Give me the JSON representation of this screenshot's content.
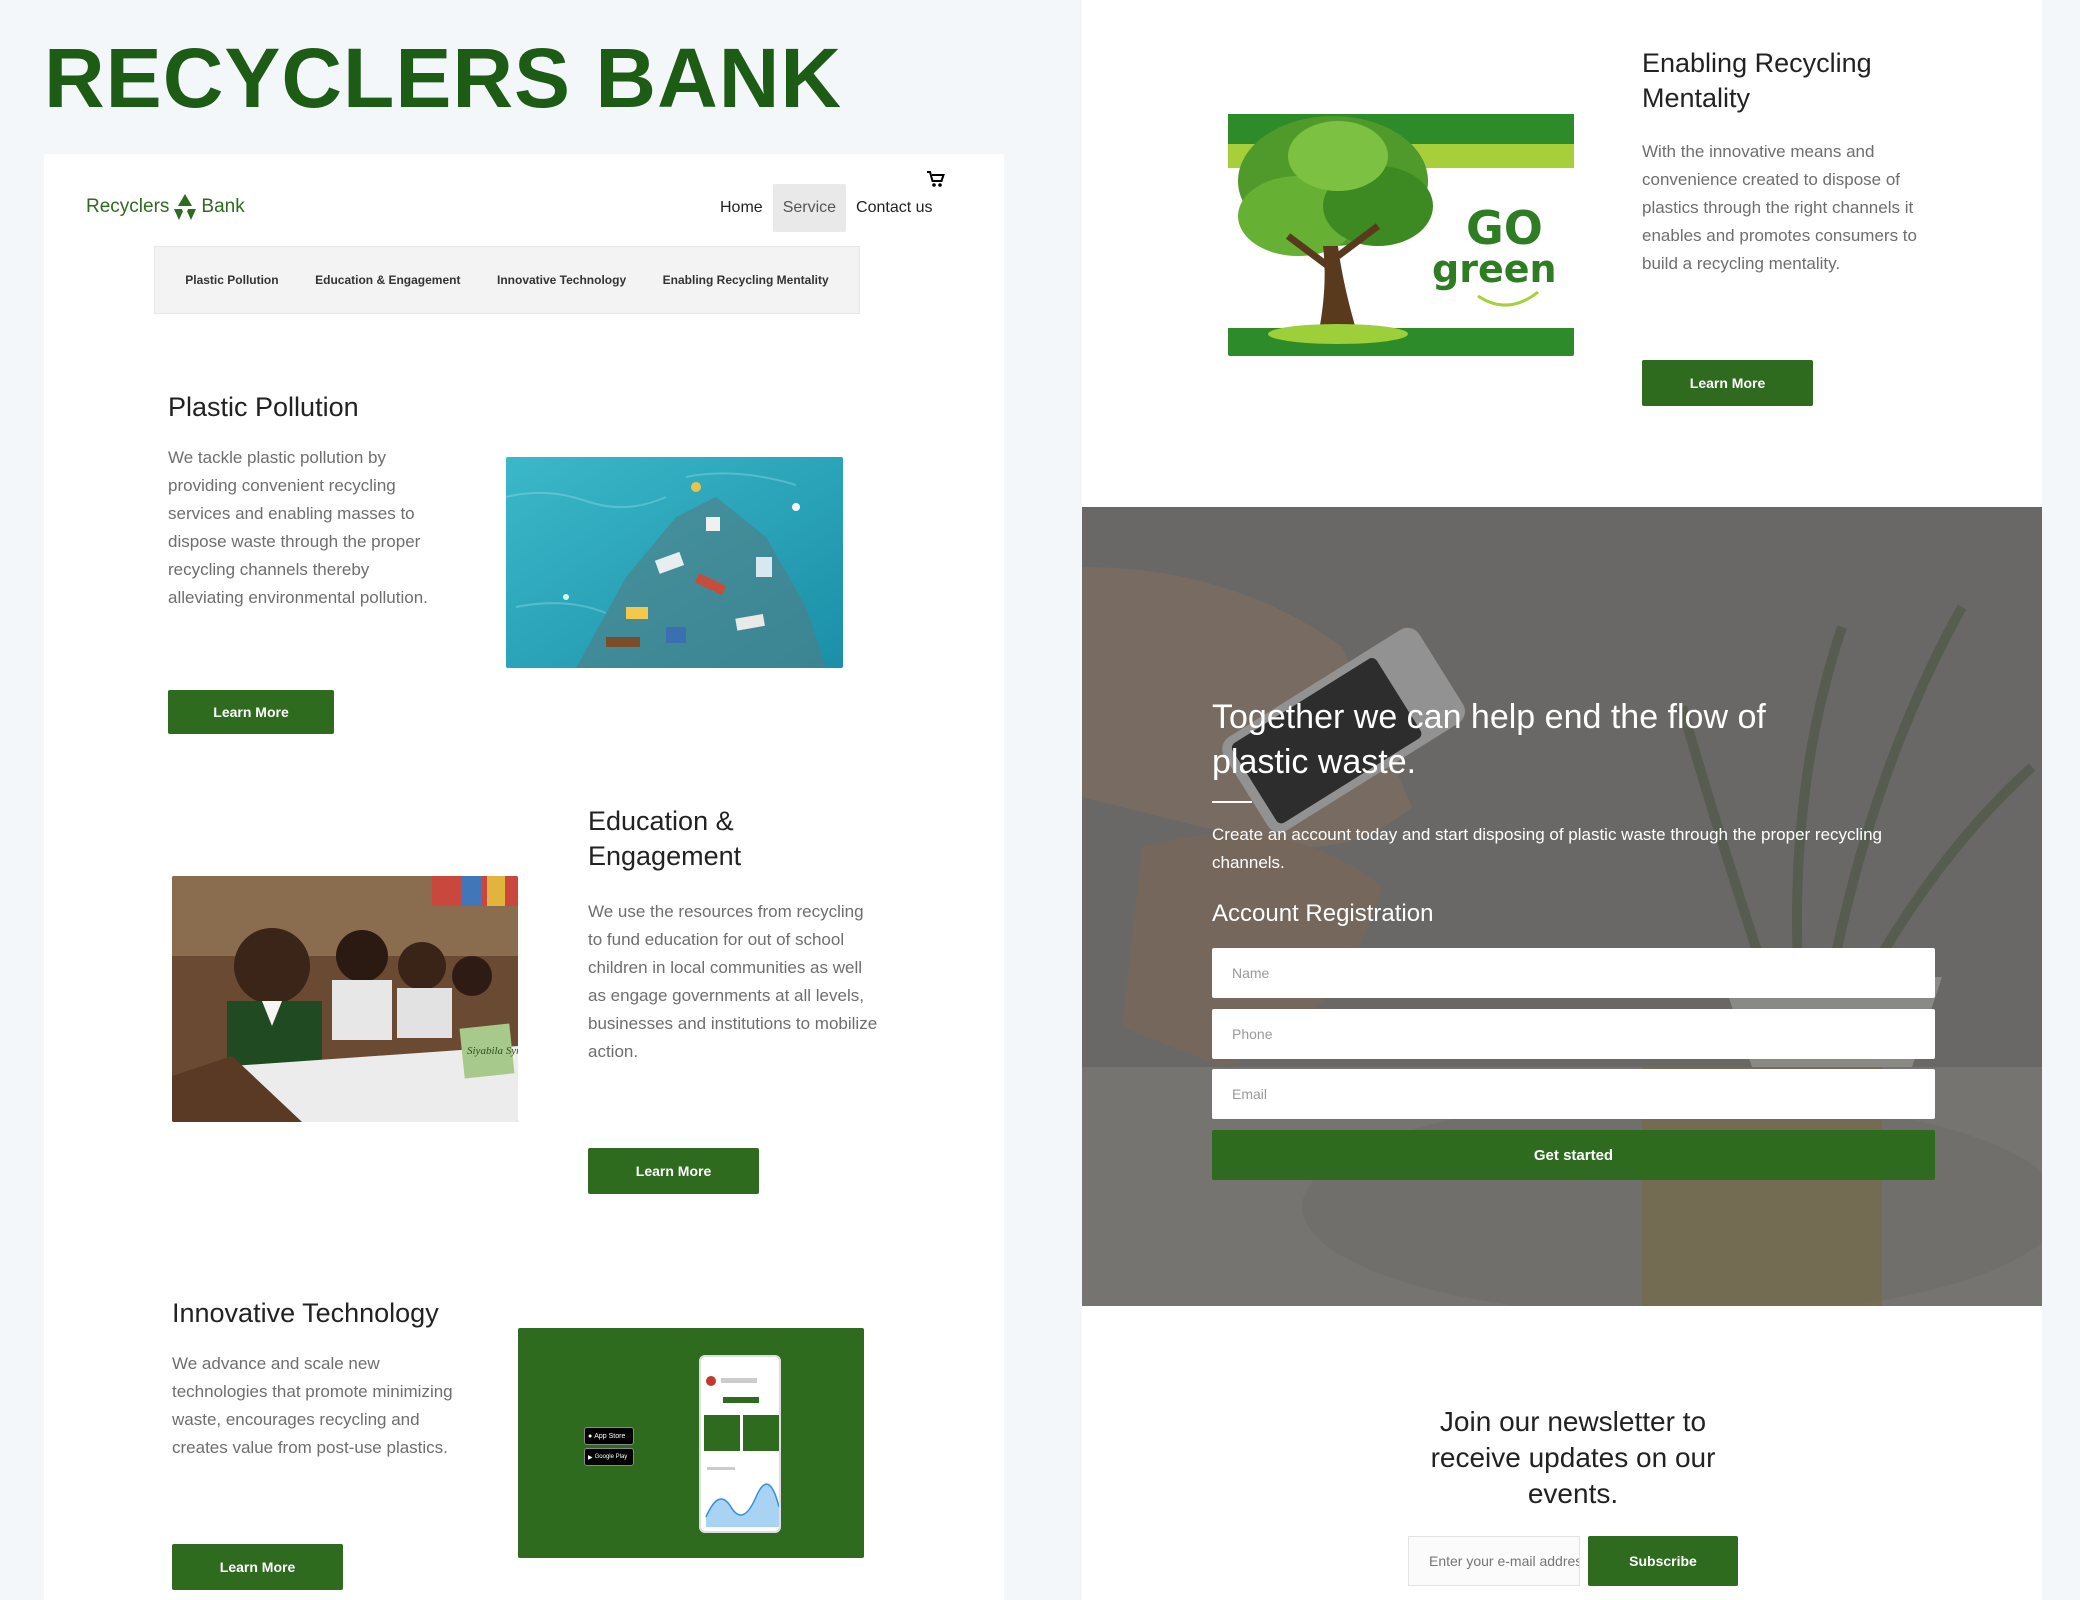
{
  "poster_title": "RECYCLERS BANK",
  "brand": {
    "left": "Recyclers",
    "right": "Bank",
    "color": "#2e6b1f"
  },
  "cart_icon": "shopping-cart-icon",
  "nav": {
    "home": "Home",
    "service": "Service",
    "contact": "Contact us"
  },
  "subnav": [
    "Plastic Pollution",
    "Education & Engagement",
    "Innovative Technology",
    "Enabling Recycling Mentality"
  ],
  "sections": {
    "plastic": {
      "title": "Plastic Pollution",
      "text": "We tackle plastic pollution by providing convenient recycling services and enabling masses to dispose waste through the proper recycling channels thereby alleviating environmental pollution.",
      "button": "Learn More"
    },
    "education": {
      "title": "Education & Engagement",
      "text": "We use the resources from recycling to fund education for out of school children in local communities as well as engage governments at all levels, businesses and institutions to mobilize action.",
      "button": "Learn More",
      "image_sign": "Siyabila Symbols"
    },
    "innovative": {
      "title": "Innovative Technology",
      "text": "We advance and scale new technologies that promote minimizing waste, encourages recycling and creates value from post-use plastics.",
      "button": "Learn More",
      "app_store": "App Store",
      "google_play": "Google Play"
    },
    "mentality": {
      "title": "Enabling Recycling Mentality",
      "text": "With the innovative means and convenience created to dispose of plastics through the right channels it enables and promotes consumers to build a recycling mentality.",
      "button": "Learn More",
      "go_text": "GO",
      "green_text": "green"
    }
  },
  "hero": {
    "title": "Together we can help end the flow of plastic waste.",
    "text": "Create an account today and start disposing of plastic waste through the proper recycling channels.",
    "form_title": "Account Registration",
    "name_placeholder": "Name",
    "phone_placeholder": "Phone",
    "email_placeholder": "Email",
    "submit": "Get started"
  },
  "newsletter": {
    "title": "Join our newsletter to receive updates on our events.",
    "placeholder": "Enter your e-mail address",
    "button": "Subscribe"
  },
  "colors": {
    "accent": "#2e6b1f",
    "title": "#1d5c14"
  }
}
